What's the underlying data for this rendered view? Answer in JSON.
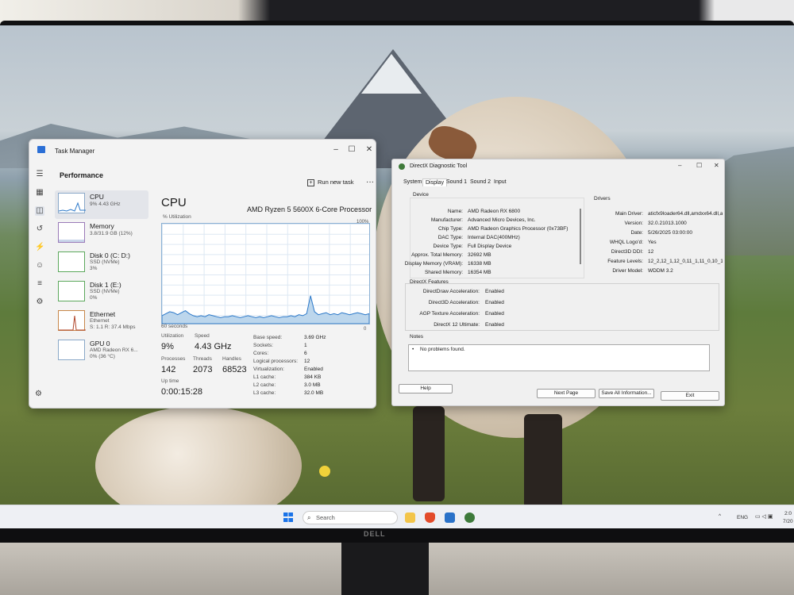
{
  "task_manager": {
    "title": "Task Manager",
    "section": "Performance",
    "run_new_task": "Run new task",
    "more": "···",
    "resources": [
      {
        "name": "CPU",
        "sub1": "9% 4.43 GHz",
        "sub2": ""
      },
      {
        "name": "Memory",
        "sub1": "3.8/31.9 GB (12%)",
        "sub2": ""
      },
      {
        "name": "Disk 0 (C: D:)",
        "sub1": "SSD (NVMe)",
        "sub2": "3%"
      },
      {
        "name": "Disk 1 (E:)",
        "sub1": "SSD (NVMe)",
        "sub2": "0%"
      },
      {
        "name": "Ethernet",
        "sub1": "Ethernet",
        "sub2": "S: 1.1 R: 37.4 Mbps"
      },
      {
        "name": "GPU 0",
        "sub1": "AMD Radeon RX 6...",
        "sub2": "0% (36 °C)"
      }
    ],
    "cpu": {
      "heading": "CPU",
      "model": "AMD Ryzen 5 5600X 6-Core Processor",
      "util_label": "% Utilization",
      "max_label": "100%",
      "time_label": "60 seconds",
      "zero_label": "0",
      "graph_values": [
        8,
        10,
        12,
        11,
        9,
        11,
        13,
        10,
        8,
        7,
        8,
        7,
        9,
        8,
        7,
        6,
        7,
        7,
        8,
        7,
        6,
        7,
        8,
        7,
        6,
        7,
        6,
        7,
        8,
        7,
        6,
        7,
        7,
        8,
        7,
        9,
        8,
        10,
        28,
        12,
        9,
        10,
        11,
        9,
        10,
        9,
        11,
        10,
        9,
        10,
        11,
        10,
        9,
        10
      ],
      "utilization_label": "Utilization",
      "utilization": "9%",
      "speed_label": "Speed",
      "speed": "4.43 GHz",
      "processes_label": "Processes",
      "processes": "142",
      "threads_label": "Threads",
      "threads": "2073",
      "handles_label": "Handles",
      "handles": "68523",
      "uptime_label": "Up time",
      "uptime": "0:00:15:28",
      "specs": [
        {
          "k": "Base speed:",
          "v": "3.69 GHz"
        },
        {
          "k": "Sockets:",
          "v": "1"
        },
        {
          "k": "Cores:",
          "v": "6"
        },
        {
          "k": "Logical processors:",
          "v": "12"
        },
        {
          "k": "Virtualization:",
          "v": "Enabled"
        },
        {
          "k": "L1 cache:",
          "v": "384 KB"
        },
        {
          "k": "L2 cache:",
          "v": "3.0 MB"
        },
        {
          "k": "L3 cache:",
          "v": "32.0 MB"
        }
      ]
    }
  },
  "dxdiag": {
    "title": "DirectX Diagnostic Tool",
    "tabs": [
      "System",
      "Display",
      "Sound 1",
      "Sound 2",
      "Input"
    ],
    "device_group": "Device",
    "device": [
      {
        "k": "Name:",
        "v": "AMD Radeon RX 6800"
      },
      {
        "k": "Manufacturer:",
        "v": "Advanced Micro Devices, Inc."
      },
      {
        "k": "Chip Type:",
        "v": "AMD Radeon Graphics Processor (0x73BF)"
      },
      {
        "k": "DAC Type:",
        "v": "Internal DAC(400MHz)"
      },
      {
        "k": "Device Type:",
        "v": "Full Display Device"
      },
      {
        "k": "Approx. Total Memory:",
        "v": "32692 MB"
      },
      {
        "k": "Display Memory (VRAM):",
        "v": "16338 MB"
      },
      {
        "k": "Shared Memory:",
        "v": "16354 MB"
      }
    ],
    "drivers_group": "Drivers",
    "drivers": [
      {
        "k": "Main Driver:",
        "v": "aticfx9loader64.dll,amdxx64.dll,amdxx"
      },
      {
        "k": "Version:",
        "v": "32.0.21013.1000"
      },
      {
        "k": "Date:",
        "v": "5/26/2025 03:00:00"
      },
      {
        "k": "WHQL Logo'd:",
        "v": "Yes"
      },
      {
        "k": "Direct3D DDI:",
        "v": "12"
      },
      {
        "k": "Feature Levels:",
        "v": "12_2,12_1,12_0,11_1,11_0,10_1,10"
      },
      {
        "k": "Driver Model:",
        "v": "WDDM 3.2"
      }
    ],
    "features_group": "DirectX Features",
    "features": [
      {
        "k": "DirectDraw Acceleration:",
        "v": "Enabled"
      },
      {
        "k": "Direct3D Acceleration:",
        "v": "Enabled"
      },
      {
        "k": "AGP Texture Acceleration:",
        "v": "Enabled"
      },
      {
        "k": "DirectX 12 Ultimate:",
        "v": "Enabled"
      }
    ],
    "notes_group": "Notes",
    "note": "No problems found.",
    "buttons": {
      "help": "Help",
      "next": "Next Page",
      "save": "Save All Information...",
      "exit": "Exit"
    }
  },
  "taskbar": {
    "search_placeholder": "Search",
    "lang": "ENG",
    "time": "2:0",
    "date": "7/20"
  },
  "monitor_brand": "DELL"
}
